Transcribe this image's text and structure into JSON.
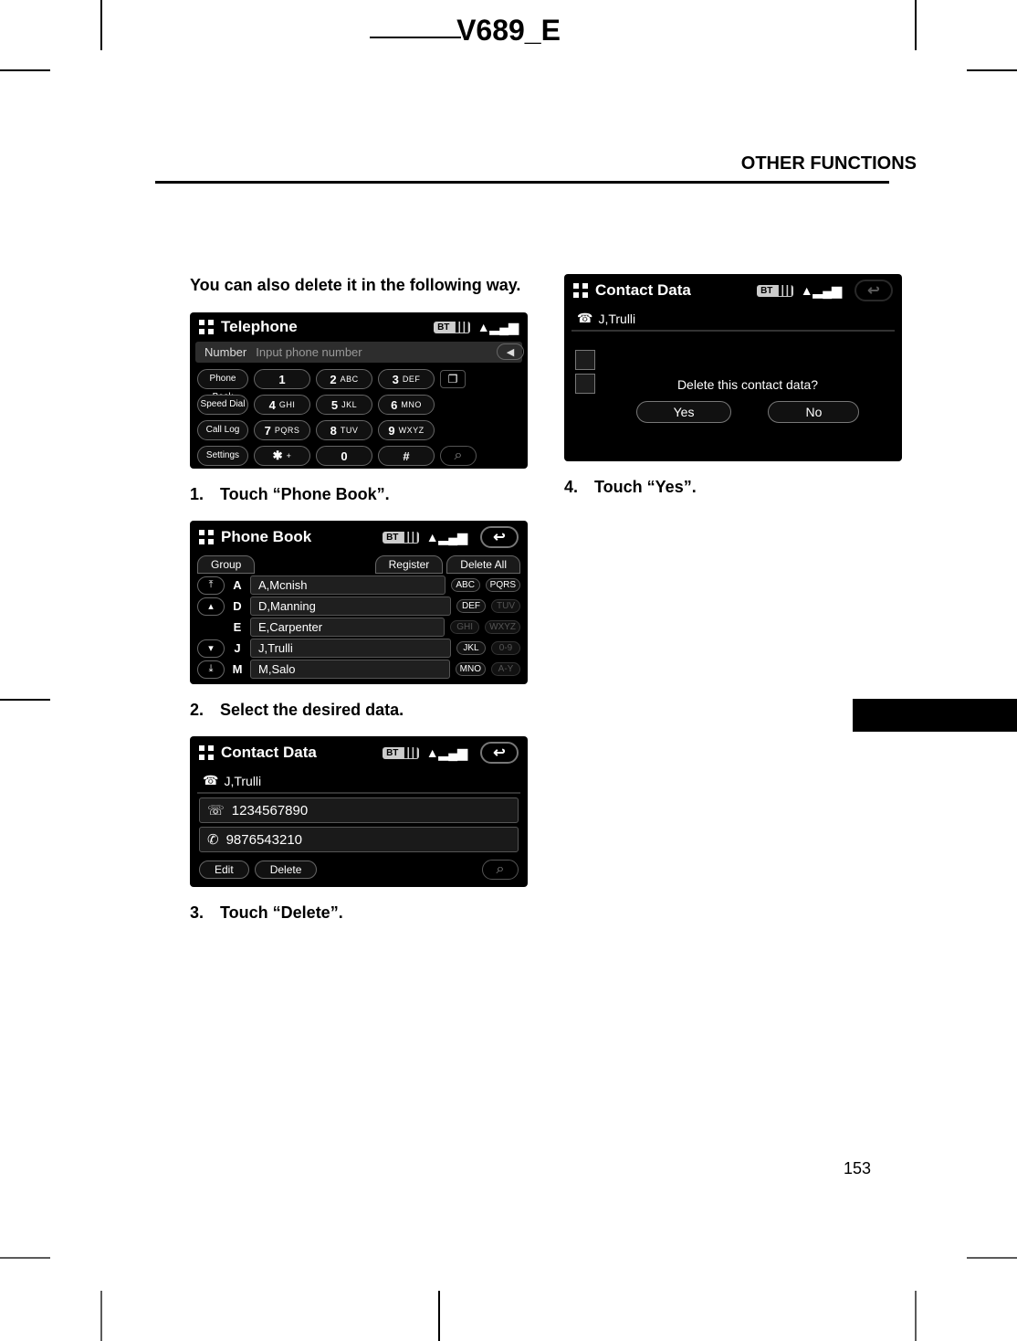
{
  "doc": {
    "header": "V689_E",
    "section": "OTHER FUNCTIONS",
    "page_number": "153"
  },
  "intro": "You can also delete it in the following way.",
  "steps": {
    "s1": "1. Touch “Phone Book”.",
    "s2": "2. Select the desired data.",
    "s3": "3. Touch “Delete”.",
    "s4": "4. Touch “Yes”."
  },
  "status": {
    "bt_label": "BT",
    "battery": "▐▐▐",
    "signal": "▲▂▄▆",
    "back_icon": "↩"
  },
  "telephone": {
    "title": "Telephone",
    "number_label": "Number",
    "number_placeholder": "Input phone number",
    "backspace_icon": "◀",
    "side": [
      "Phone\nBook",
      "Speed Dial",
      "Call Log",
      "Settings"
    ],
    "keys": [
      {
        "n": "1",
        "l": ""
      },
      {
        "n": "2",
        "l": "ABC"
      },
      {
        "n": "3",
        "l": "DEF"
      },
      {
        "n": "4",
        "l": "GHI"
      },
      {
        "n": "5",
        "l": "JKL"
      },
      {
        "n": "6",
        "l": "MNO"
      },
      {
        "n": "7",
        "l": "PQRS"
      },
      {
        "n": "8",
        "l": "TUV"
      },
      {
        "n": "9",
        "l": "WXYZ"
      },
      {
        "n": "✱",
        "l": "+"
      },
      {
        "n": "0",
        "l": ""
      },
      {
        "n": "#",
        "l": ""
      }
    ],
    "window_icon": "❐",
    "hangup_icon": "⌕"
  },
  "phonebook": {
    "title": "Phone Book",
    "tabs": {
      "group": "Group",
      "register": "Register",
      "delete_all": "Delete All"
    },
    "arrows": {
      "top": "⤒",
      "up": "▴",
      "down": "▾",
      "bottom": "⤓"
    },
    "rows": [
      {
        "letter": "A",
        "name": "A,Mcnish",
        "f1": "ABC",
        "f2": "PQRS",
        "dim": false
      },
      {
        "letter": "D",
        "name": "D,Manning",
        "f1": "DEF",
        "f2": "TUV",
        "dim": true
      },
      {
        "letter": "E",
        "name": "E,Carpenter",
        "f1": "GHI",
        "f2": "WXYZ",
        "dim": true
      },
      {
        "letter": "J",
        "name": "J,Trulli",
        "f1": "JKL",
        "f2": "0-9",
        "dim": true
      },
      {
        "letter": "M",
        "name": "M,Salo",
        "f1": "MNO",
        "f2": "A-Y",
        "dim": true
      }
    ]
  },
  "contactdata": {
    "title": "Contact Data",
    "name_icon": "☎",
    "name": "J,Trulli",
    "numbers": [
      {
        "icon": "☏",
        "value": "1234567890"
      },
      {
        "icon": "✆",
        "value": "9876543210"
      }
    ],
    "buttons": {
      "edit": "Edit",
      "delete": "Delete"
    },
    "hangup_icon": "⌕"
  },
  "confirm": {
    "title": "Contact Data",
    "name_icon": "☎",
    "name": "J,Trulli",
    "message": "Delete this contact data?",
    "yes": "Yes",
    "no": "No"
  }
}
